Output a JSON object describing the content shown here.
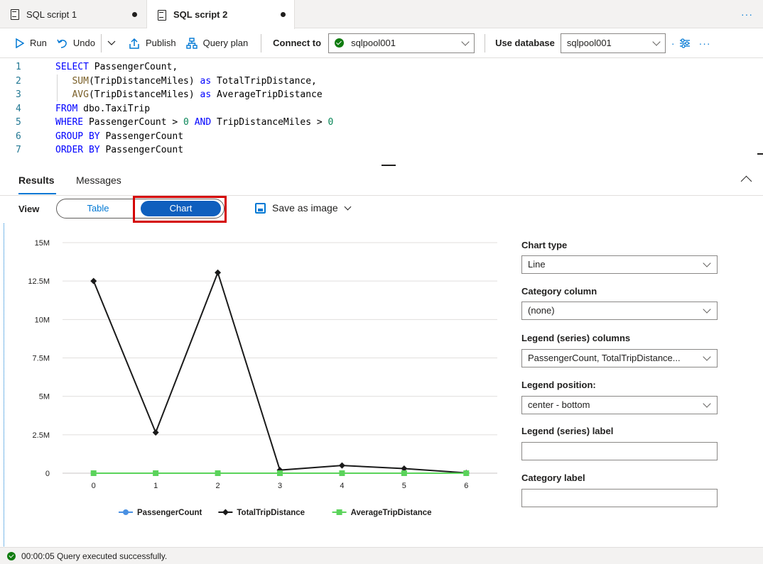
{
  "tabs": [
    {
      "label": "SQL script 1",
      "unsaved": true
    },
    {
      "label": "SQL script 2",
      "unsaved": true,
      "active": true
    }
  ],
  "toolbar": {
    "run": "Run",
    "undo": "Undo",
    "publish": "Publish",
    "query_plan": "Query plan",
    "connect_to_label": "Connect to",
    "connect_to_value": "sqlpool001",
    "use_database_label": "Use database",
    "use_database_value": "sqlpool001"
  },
  "editor": {
    "lines": [
      {
        "n": "1",
        "tokens": [
          [
            "kw",
            "SELECT"
          ],
          [
            "",
            " PassengerCount,"
          ]
        ]
      },
      {
        "n": "2",
        "tokens": [
          [
            "",
            "   "
          ],
          [
            "fn",
            "SUM"
          ],
          [
            "",
            "(TripDistanceMiles) "
          ],
          [
            "kw",
            "as"
          ],
          [
            "",
            " TotalTripDistance,"
          ]
        ]
      },
      {
        "n": "3",
        "tokens": [
          [
            "",
            "   "
          ],
          [
            "fn",
            "AVG"
          ],
          [
            "",
            "(TripDistanceMiles) "
          ],
          [
            "kw",
            "as"
          ],
          [
            "",
            " AverageTripDistance"
          ]
        ]
      },
      {
        "n": "4",
        "tokens": [
          [
            "kw",
            "FROM"
          ],
          [
            "",
            " dbo.TaxiTrip"
          ]
        ]
      },
      {
        "n": "5",
        "tokens": [
          [
            "kw",
            "WHERE"
          ],
          [
            "",
            " PassengerCount > "
          ],
          [
            "num",
            "0"
          ],
          [
            "",
            " "
          ],
          [
            "kw",
            "AND"
          ],
          [
            "",
            " TripDistanceMiles > "
          ],
          [
            "num",
            "0"
          ]
        ]
      },
      {
        "n": "6",
        "tokens": [
          [
            "kw",
            "GROUP BY"
          ],
          [
            "",
            " PassengerCount"
          ]
        ]
      },
      {
        "n": "7",
        "tokens": [
          [
            "kw",
            "ORDER BY"
          ],
          [
            "",
            " PassengerCount"
          ]
        ]
      }
    ]
  },
  "results": {
    "tab_results": "Results",
    "tab_messages": "Messages",
    "view_label": "View",
    "view_table": "Table",
    "view_chart": "Chart",
    "save_as_image": "Save as image"
  },
  "chart_data": {
    "type": "line",
    "x": [
      0,
      1,
      2,
      3,
      4,
      5,
      6
    ],
    "series": [
      {
        "name": "PassengerCount",
        "color": "#4a90e2",
        "marker": "circle",
        "values": [
          0,
          1,
          2,
          3,
          4,
          5,
          6
        ]
      },
      {
        "name": "TotalTripDistance",
        "color": "#1a1a1a",
        "marker": "diamond",
        "values": [
          12500000,
          2650000,
          13050000,
          200000,
          500000,
          300000,
          20000
        ]
      },
      {
        "name": "AverageTripDistance",
        "color": "#5bd35b",
        "marker": "square",
        "values": [
          3,
          3,
          3,
          3,
          3,
          3,
          3
        ]
      }
    ],
    "yticks": [
      "0",
      "2.5M",
      "5M",
      "7.5M",
      "10M",
      "12.5M",
      "15M"
    ],
    "ylim": [
      0,
      15000000
    ],
    "grid": true,
    "legend": "bottom-center"
  },
  "settings": {
    "chart_type_label": "Chart type",
    "chart_type_value": "Line",
    "category_column_label": "Category column",
    "category_column_value": "(none)",
    "legend_columns_label": "Legend (series) columns",
    "legend_columns_value": "PassengerCount, TotalTripDistance...",
    "legend_position_label": "Legend position:",
    "legend_position_value": "center - bottom",
    "legend_label_label": "Legend (series) label",
    "legend_label_value": "",
    "category_label_label": "Category label",
    "category_label_value": ""
  },
  "status": {
    "text": "00:00:05 Query executed successfully."
  },
  "colors": {
    "accent": "#0078d4",
    "success": "#107c10",
    "highlight": "#d40000"
  }
}
